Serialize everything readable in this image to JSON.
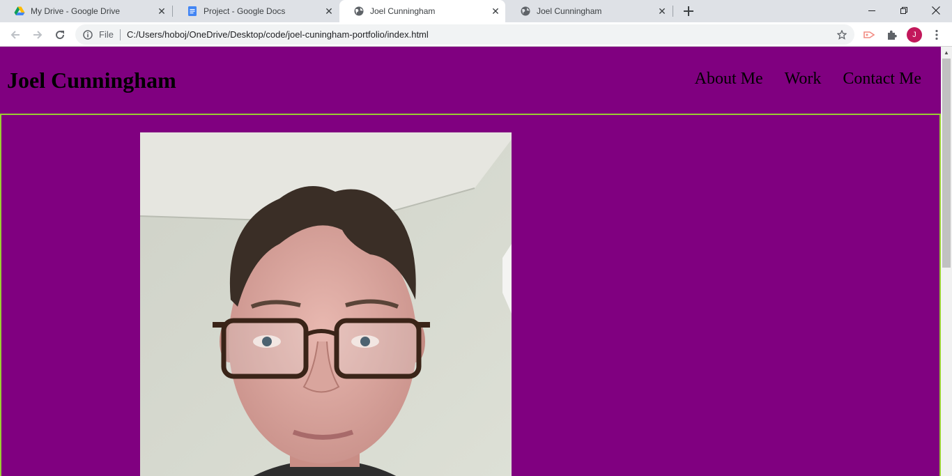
{
  "browser": {
    "tabs": [
      {
        "title": "My Drive - Google Drive",
        "icon": "google-drive-icon"
      },
      {
        "title": "Project - Google Docs",
        "icon": "google-docs-icon"
      },
      {
        "title": "Joel Cunningham",
        "icon": "globe-icon"
      },
      {
        "title": "Joel Cunningham",
        "icon": "globe-icon"
      }
    ],
    "active_tab_index": 2,
    "address": {
      "scheme_label": "File",
      "url": "C:/Users/hoboj/OneDrive/Desktop/code/joel-cuningham-portfolio/index.html"
    },
    "profile_initial": "J"
  },
  "site": {
    "title": "Joel Cunningham",
    "nav": [
      "About Me",
      "Work",
      "Contact Me"
    ]
  },
  "colors": {
    "page_background": "#800080",
    "content_border": "#9acd32",
    "profile_avatar": "#c2185b"
  }
}
